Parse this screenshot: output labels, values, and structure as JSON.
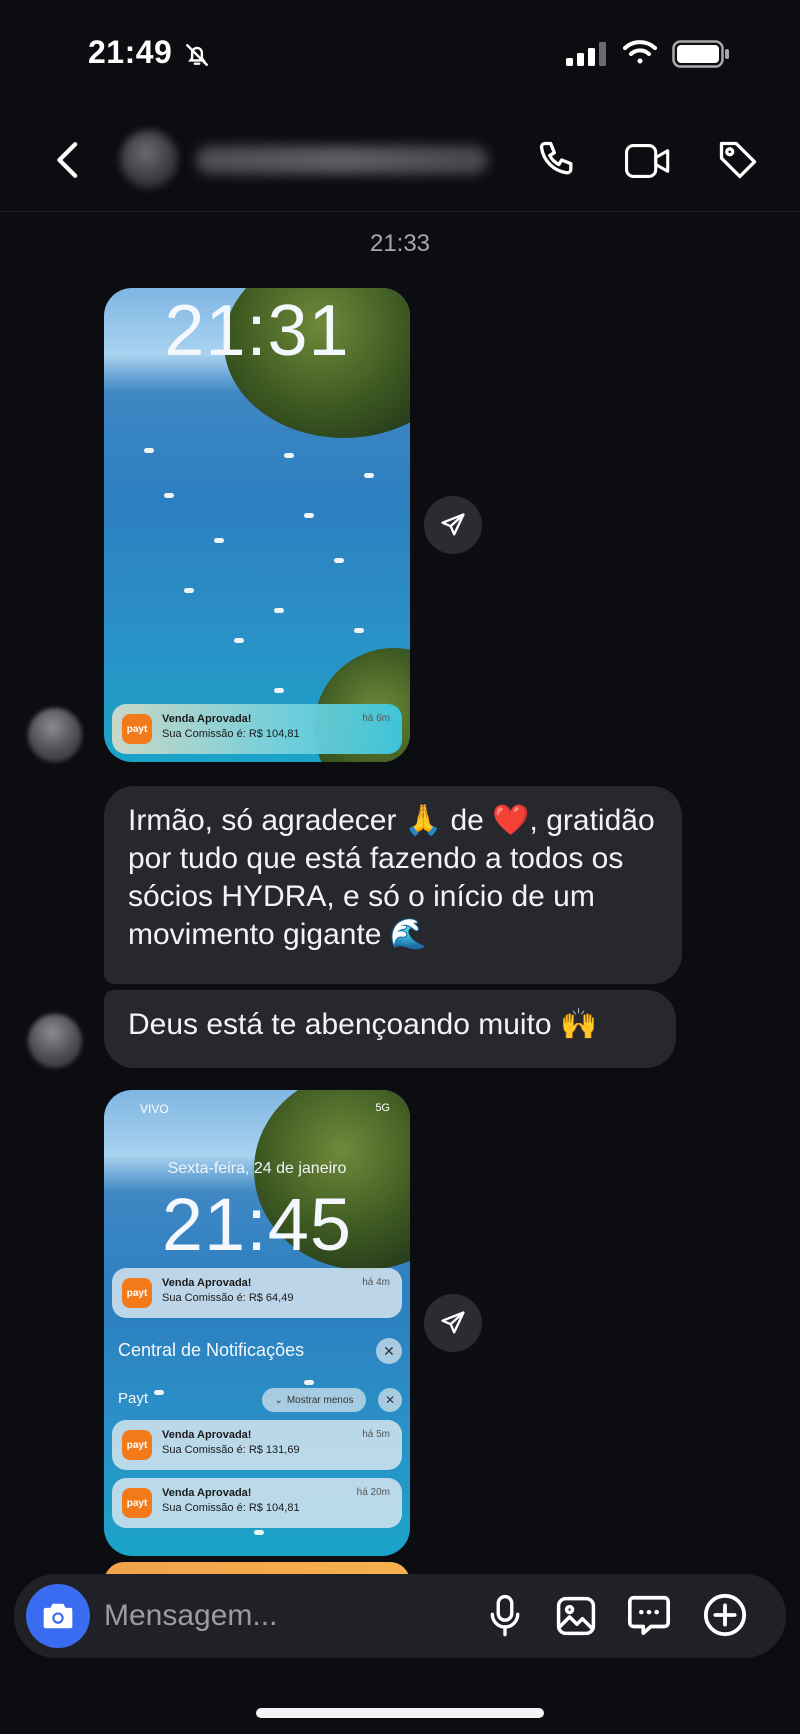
{
  "status_bar": {
    "time": "21:49",
    "icons": [
      "bell-muted-icon",
      "signal-icon",
      "wifi-icon",
      "battery-icon"
    ]
  },
  "header": {
    "icons": [
      "back-icon",
      "call-icon",
      "video-icon",
      "tag-icon"
    ]
  },
  "thread": {
    "timestamp": "21:33",
    "image_1": {
      "lock_time": "21:31",
      "notification": {
        "logo": "payt",
        "title": "Venda Aprovada!",
        "body": "Sua Comissão é: R$ 104,81",
        "time": "há 6m"
      }
    },
    "message_1": "Irmão, só agradecer 🙏 de ❤️, gratidão por tudo que está fazendo a todos os sócios HYDRA, e só o início de um movimento gigante 🌊",
    "message_2": "Deus está te abençoando muito 🙌",
    "image_2": {
      "carrier": "VIVO",
      "network": "5G",
      "date": "Sexta-feira, 24 de janeiro",
      "lock_time": "21:45",
      "notification_top": {
        "logo": "payt",
        "title": "Venda Aprovada!",
        "body": "Sua Comissão é: R$ 64,49",
        "time": "há 4m"
      },
      "center_title": "Central de Notificações",
      "group_label": "Payt",
      "show_less": "Mostrar menos",
      "notifications": [
        {
          "logo": "payt",
          "title": "Venda Aprovada!",
          "body": "Sua Comissão é: R$ 131,69",
          "time": "há 5m"
        },
        {
          "logo": "payt",
          "title": "Venda Aprovada!",
          "body": "Sua Comissão é: R$ 104,81",
          "time": "há 20m"
        }
      ]
    }
  },
  "composer": {
    "placeholder": "Mensagem...",
    "icons": [
      "camera-icon",
      "mic-icon",
      "gallery-icon",
      "sticker-icon",
      "plus-icon"
    ]
  },
  "colors": {
    "background": "#0c0d10",
    "bubble": "#26282d",
    "camera_button": "#3a6cf2",
    "payt_orange": "#f27a1a"
  }
}
